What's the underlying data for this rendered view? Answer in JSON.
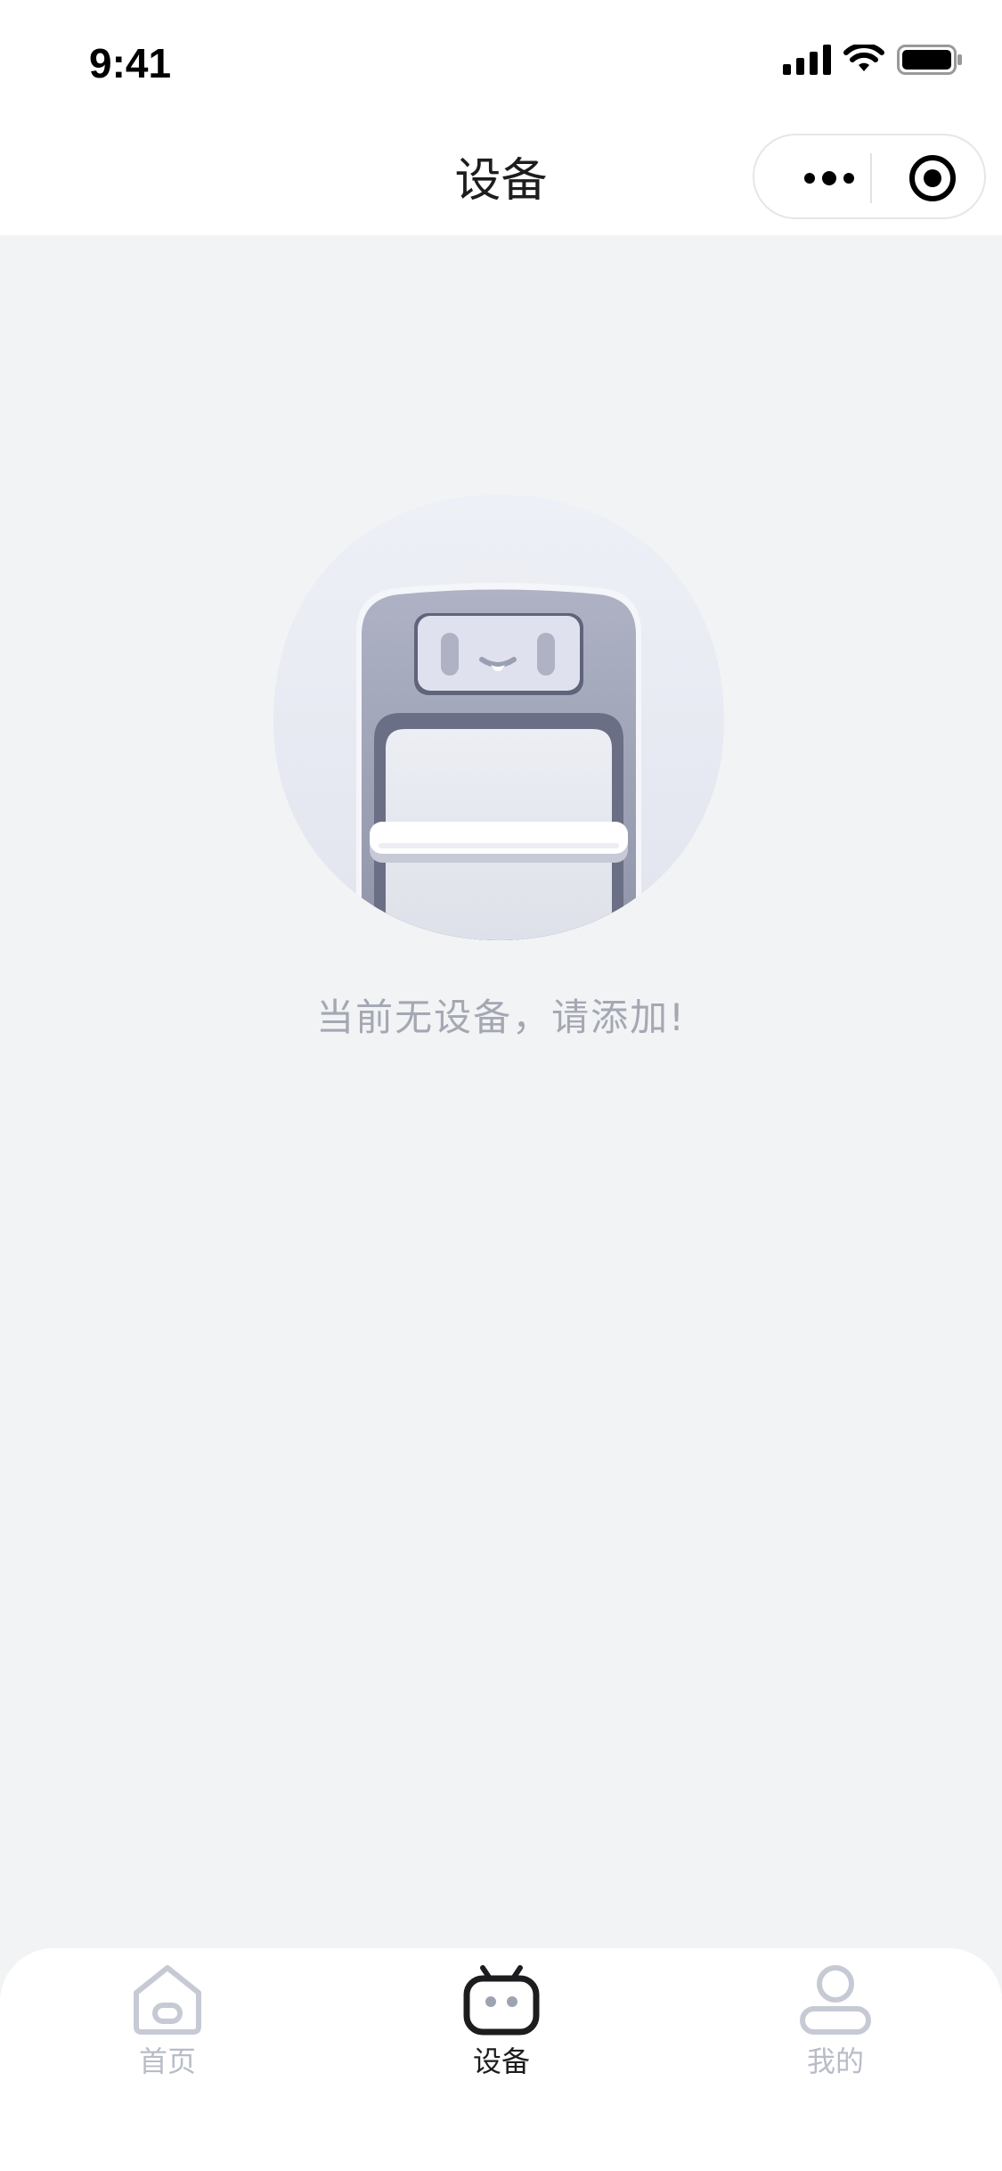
{
  "status_bar": {
    "time": "9:41",
    "icons": [
      "cellular-signal-icon",
      "wifi-icon",
      "battery-icon"
    ]
  },
  "nav": {
    "title": "设备",
    "capsule_icons": [
      "more-icon",
      "target-icon"
    ]
  },
  "empty_state": {
    "illustration": "robot-illustration",
    "message": "当前无设备，请添加!"
  },
  "tab_bar": {
    "items": [
      {
        "label": "首页",
        "icon": "home-icon",
        "active": false
      },
      {
        "label": "设备",
        "icon": "device-icon",
        "active": true
      },
      {
        "label": "我的",
        "icon": "profile-icon",
        "active": false
      }
    ]
  },
  "colors": {
    "background": "#f2f3f5",
    "active_tab": "#1d1d1f",
    "inactive_tab": "#b8bcc8",
    "empty_text": "#a4a8b3"
  }
}
